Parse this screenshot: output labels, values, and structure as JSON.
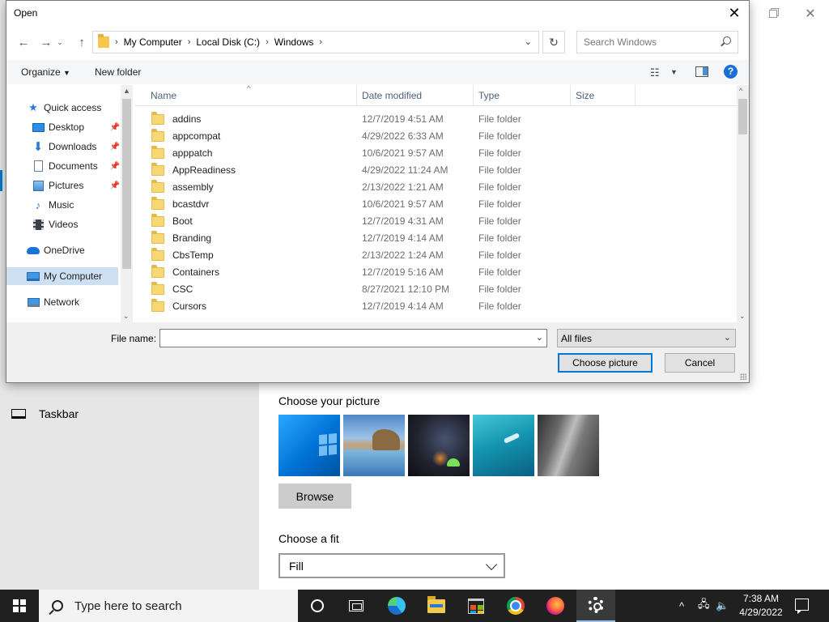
{
  "settings": {
    "nav_taskbar_label": "Taskbar",
    "choose_picture_title": "Choose your picture",
    "browse_label": "Browse",
    "choose_fit_title": "Choose a fit",
    "fit_value": "Fill"
  },
  "dialog": {
    "title": "Open",
    "breadcrumb": [
      "My Computer",
      "Local Disk (C:)",
      "Windows"
    ],
    "search_placeholder": "Search Windows",
    "toolbar": {
      "organize": "Organize",
      "new_folder": "New folder"
    },
    "nav": [
      {
        "label": "Quick access",
        "icon": "star-icon"
      },
      {
        "label": "Desktop",
        "icon": "desktop-icon",
        "pinned": true
      },
      {
        "label": "Downloads",
        "icon": "download-icon",
        "pinned": true
      },
      {
        "label": "Documents",
        "icon": "document-icon",
        "pinned": true
      },
      {
        "label": "Pictures",
        "icon": "picture-icon",
        "pinned": true
      },
      {
        "label": "Music",
        "icon": "music-icon"
      },
      {
        "label": "Videos",
        "icon": "video-icon"
      },
      {
        "label": "OneDrive",
        "icon": "cloud-icon"
      },
      {
        "label": "My Computer",
        "icon": "computer-icon",
        "selected": true
      },
      {
        "label": "Network",
        "icon": "network-icon"
      }
    ],
    "columns": {
      "name": "Name",
      "date": "Date modified",
      "type": "Type",
      "size": "Size"
    },
    "files": [
      {
        "name": "addins",
        "date": "12/7/2019 4:51 AM",
        "type": "File folder"
      },
      {
        "name": "appcompat",
        "date": "4/29/2022 6:33 AM",
        "type": "File folder"
      },
      {
        "name": "apppatch",
        "date": "10/6/2021 9:57 AM",
        "type": "File folder"
      },
      {
        "name": "AppReadiness",
        "date": "4/29/2022 11:24 AM",
        "type": "File folder"
      },
      {
        "name": "assembly",
        "date": "2/13/2022 1:21 AM",
        "type": "File folder"
      },
      {
        "name": "bcastdvr",
        "date": "10/6/2021 9:57 AM",
        "type": "File folder"
      },
      {
        "name": "Boot",
        "date": "12/7/2019 4:31 AM",
        "type": "File folder"
      },
      {
        "name": "Branding",
        "date": "12/7/2019 4:14 AM",
        "type": "File folder"
      },
      {
        "name": "CbsTemp",
        "date": "2/13/2022 1:24 AM",
        "type": "File folder"
      },
      {
        "name": "Containers",
        "date": "12/7/2019 5:16 AM",
        "type": "File folder"
      },
      {
        "name": "CSC",
        "date": "8/27/2021 12:10 PM",
        "type": "File folder"
      },
      {
        "name": "Cursors",
        "date": "12/7/2019 4:14 AM",
        "type": "File folder"
      }
    ],
    "file_name_label": "File name:",
    "file_name_value": "",
    "file_type": "All files",
    "choose_button": "Choose picture",
    "cancel_button": "Cancel"
  },
  "taskbar": {
    "search_placeholder": "Type here to search",
    "time": "7:38 AM",
    "date": "4/29/2022"
  }
}
